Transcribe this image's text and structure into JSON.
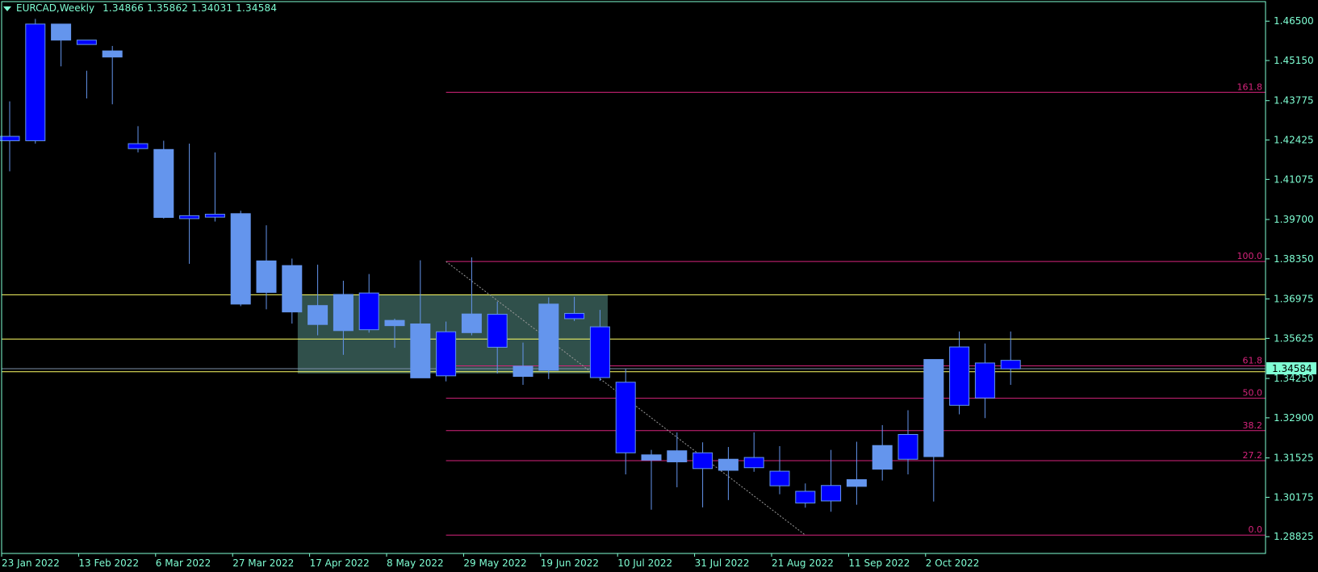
{
  "header": {
    "symbol_timeframe": "EURCAD,Weekly",
    "ohlc": "1.34866 1.35862 1.34031 1.34584",
    "menu_icon": "triangle-down-icon"
  },
  "colors": {
    "background": "#000000",
    "bull": "#6495ed",
    "bear": "#0000ff",
    "wick": "#6495ed",
    "axis_text": "#7fffd4",
    "fib": "#d6247c",
    "level": "#ffff66",
    "zone": "#385e58",
    "price_tag": "#7fffd4"
  },
  "chart_data": {
    "type": "candlestick",
    "symbol": "EURCAD",
    "timeframe": "Weekly",
    "ylim": [
      1.2825,
      1.4717
    ],
    "y_ticks": [
      "1.46500",
      "1.45150",
      "1.43775",
      "1.42425",
      "1.41075",
      "1.39700",
      "1.38350",
      "1.36975",
      "1.35625",
      "1.34250",
      "1.32900",
      "1.31525",
      "1.30175",
      "1.28825"
    ],
    "y_tick_values": [
      1.465,
      1.4515,
      1.43775,
      1.42425,
      1.41075,
      1.397,
      1.3835,
      1.36975,
      1.35625,
      1.3425,
      1.329,
      1.31525,
      1.30175,
      1.28825
    ],
    "x_labels": [
      "23 Jan 2022",
      "13 Feb 2022",
      "6 Mar 2022",
      "27 Mar 2022",
      "17 Apr 2022",
      "8 May 2022",
      "29 May 2022",
      "19 Jun 2022",
      "10 Jul 2022",
      "31 Jul 2022",
      "21 Aug 2022",
      "11 Sep 2022",
      "2 Oct 2022"
    ],
    "x_label_index": [
      0,
      3,
      6,
      9,
      12,
      15,
      18,
      21,
      24,
      27,
      30,
      33,
      36
    ],
    "candles": [
      {
        "o": 1.4255,
        "h": 1.4375,
        "l": 1.4135,
        "c": 1.424
      },
      {
        "o": 1.464,
        "h": 1.4658,
        "l": 1.423,
        "c": 1.424
      },
      {
        "o": 1.4585,
        "h": 1.4638,
        "l": 1.4495,
        "c": 1.464
      },
      {
        "o": 1.4585,
        "h": 1.448,
        "l": 1.4385,
        "c": 1.457
      },
      {
        "o": 1.4527,
        "h": 1.4565,
        "l": 1.4365,
        "c": 1.4548
      },
      {
        "o": 1.423,
        "h": 1.429,
        "l": 1.42,
        "c": 1.4213
      },
      {
        "o": 1.3977,
        "h": 1.424,
        "l": 1.3973,
        "c": 1.421
      },
      {
        "o": 1.3983,
        "h": 1.423,
        "l": 1.3818,
        "c": 1.3973
      },
      {
        "o": 1.3988,
        "h": 1.42,
        "l": 1.3963,
        "c": 1.3978
      },
      {
        "o": 1.368,
        "h": 1.4,
        "l": 1.3673,
        "c": 1.399
      },
      {
        "o": 1.372,
        "h": 1.395,
        "l": 1.3662,
        "c": 1.3828
      },
      {
        "o": 1.3653,
        "h": 1.3836,
        "l": 1.3613,
        "c": 1.3812
      },
      {
        "o": 1.361,
        "h": 1.3815,
        "l": 1.3573,
        "c": 1.3675
      },
      {
        "o": 1.3589,
        "h": 1.376,
        "l": 1.3506,
        "c": 1.3713
      },
      {
        "o": 1.3718,
        "h": 1.3783,
        "l": 1.3582,
        "c": 1.3592
      },
      {
        "o": 1.3606,
        "h": 1.363,
        "l": 1.353,
        "c": 1.3624
      },
      {
        "o": 1.3427,
        "h": 1.383,
        "l": 1.3431,
        "c": 1.3612
      },
      {
        "o": 1.3585,
        "h": 1.362,
        "l": 1.3415,
        "c": 1.3434
      },
      {
        "o": 1.3582,
        "h": 1.384,
        "l": 1.3573,
        "c": 1.3646
      },
      {
        "o": 1.3645,
        "h": 1.3688,
        "l": 1.3442,
        "c": 1.3532
      },
      {
        "o": 1.3432,
        "h": 1.3548,
        "l": 1.3403,
        "c": 1.3467
      },
      {
        "o": 1.3453,
        "h": 1.3703,
        "l": 1.3423,
        "c": 1.368
      },
      {
        "o": 1.3648,
        "h": 1.3705,
        "l": 1.3622,
        "c": 1.363
      },
      {
        "o": 1.3602,
        "h": 1.366,
        "l": 1.3417,
        "c": 1.3428
      },
      {
        "o": 1.3412,
        "h": 1.3457,
        "l": 1.3096,
        "c": 1.317
      },
      {
        "o": 1.3145,
        "h": 1.318,
        "l": 1.2975,
        "c": 1.3163
      },
      {
        "o": 1.3139,
        "h": 1.324,
        "l": 1.3052,
        "c": 1.3177
      },
      {
        "o": 1.317,
        "h": 1.3206,
        "l": 1.2983,
        "c": 1.3116
      },
      {
        "o": 1.311,
        "h": 1.319,
        "l": 1.3008,
        "c": 1.3148
      },
      {
        "o": 1.3154,
        "h": 1.324,
        "l": 1.3105,
        "c": 1.3119
      },
      {
        "o": 1.3107,
        "h": 1.3193,
        "l": 1.3028,
        "c": 1.3057
      },
      {
        "o": 1.3038,
        "h": 1.3065,
        "l": 1.2982,
        "c": 1.2998
      },
      {
        "o": 1.3058,
        "h": 1.318,
        "l": 1.2968,
        "c": 1.3005
      },
      {
        "o": 1.3055,
        "h": 1.3208,
        "l": 1.2992,
        "c": 1.3078
      },
      {
        "o": 1.3114,
        "h": 1.3265,
        "l": 1.3075,
        "c": 1.3195
      },
      {
        "o": 1.3233,
        "h": 1.3316,
        "l": 1.3096,
        "c": 1.3148
      },
      {
        "o": 1.3157,
        "h": 1.3264,
        "l": 1.3003,
        "c": 1.349
      },
      {
        "o": 1.3533,
        "h": 1.3586,
        "l": 1.3302,
        "c": 1.3333
      },
      {
        "o": 1.3478,
        "h": 1.3545,
        "l": 1.3289,
        "c": 1.3358
      },
      {
        "o": 1.3487,
        "h": 1.3586,
        "l": 1.3403,
        "c": 1.3458
      }
    ],
    "horizontal_levels": [
      1.3712,
      1.356,
      1.3448
    ],
    "current_price": "1.34584",
    "current_price_value": 1.34584,
    "fibonacci": {
      "high": 1.3826,
      "low": 1.2888,
      "levels": [
        {
          "label": "161.8",
          "value": 1.4406
        },
        {
          "label": "100.0",
          "value": 1.3826
        },
        {
          "label": "61.8",
          "value": 1.3468
        },
        {
          "label": "50.0",
          "value": 1.3357
        },
        {
          "label": "38.2",
          "value": 1.3246
        },
        {
          "label": "27.2",
          "value": 1.3143
        },
        {
          "label": "0.0",
          "value": 1.2888
        }
      ],
      "start_index": 17
    },
    "zone": {
      "from_index": 11.6,
      "to_index": 23.3,
      "top": 1.3712,
      "bottom": 1.3442
    },
    "trendline": {
      "from_index": 17,
      "from_price": 1.3826,
      "to_index": 31,
      "to_price": 1.2888
    }
  }
}
